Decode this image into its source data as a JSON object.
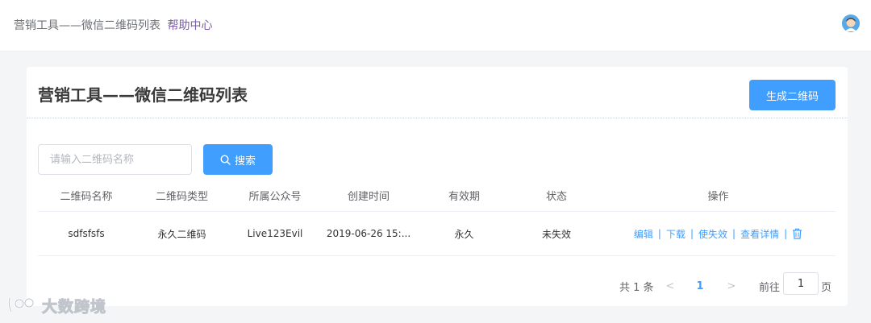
{
  "header": {
    "breadcrumb": "营销工具——微信二维码列表",
    "help_link": "帮助中心",
    "avatar_icon": "user-avatar"
  },
  "page": {
    "title": "营销工具——微信二维码列表",
    "generate_button": "生成二维码"
  },
  "search": {
    "placeholder": "请输入二维码名称",
    "value": "",
    "button_label": "搜索",
    "button_icon": "search-icon"
  },
  "table": {
    "columns": [
      "二维码名称",
      "二维码类型",
      "所属公众号",
      "创建时间",
      "有效期",
      "状态",
      "操作"
    ],
    "rows": [
      {
        "name": "sdfsfsfs",
        "type": "永久二维码",
        "account": "Live123Evil",
        "created": "2019-06-26 15:...",
        "validity": "永久",
        "status": "未失效",
        "actions": [
          "编辑",
          "下载",
          "使失效",
          "查看详情"
        ],
        "delete_icon": "trash-icon"
      }
    ]
  },
  "pagination": {
    "total": "共 1 条",
    "prev": "<",
    "current": "1",
    "next": ">",
    "goto_label": "前往",
    "goto_value": "1",
    "unit": "页"
  },
  "watermark": {
    "text": "大数跨境"
  },
  "colors": {
    "primary": "#409eff",
    "help_link": "#7b5ea7",
    "background": "#f4f5f7"
  }
}
